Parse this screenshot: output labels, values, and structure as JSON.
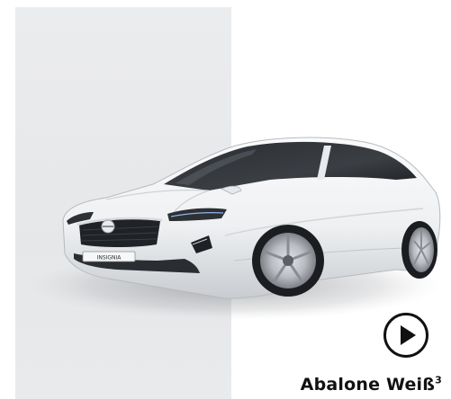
{
  "vehicle": {
    "plate_text": "INSIGNIA",
    "color_name": "Abalone Weiß",
    "color_footnote": "3",
    "paint_color": "#f2f3f5"
  },
  "media": {
    "play_icon": "play-circle-icon"
  },
  "colors": {
    "backdrop": "#e8e9eb",
    "text": "#111111"
  }
}
